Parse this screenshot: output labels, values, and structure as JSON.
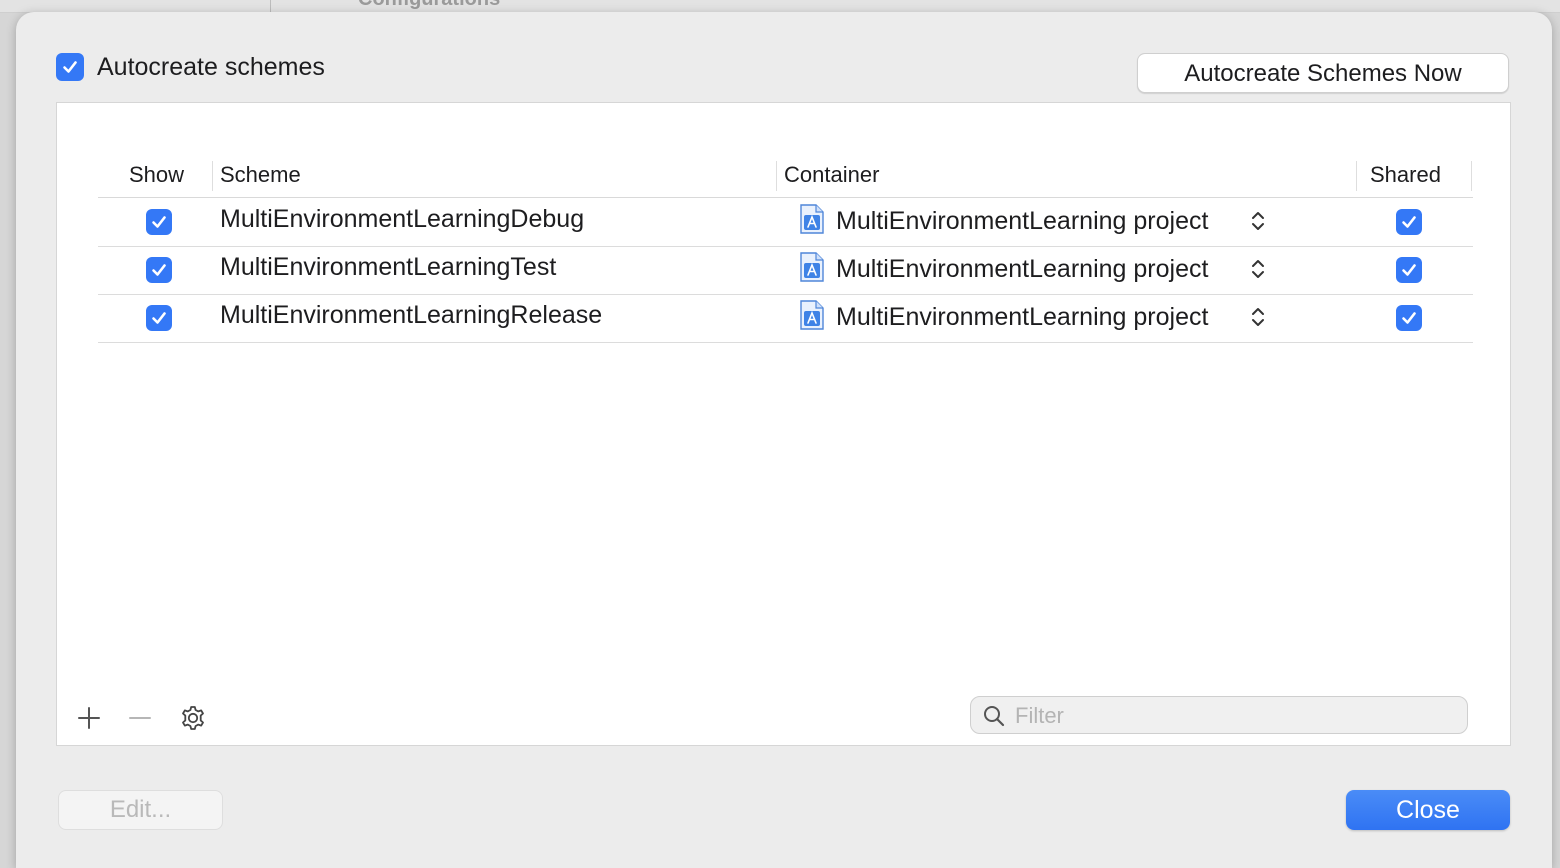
{
  "background": {
    "heading_text": "Configurations"
  },
  "header": {
    "autocreate_label": "Autocreate schemes",
    "autocreate_checked": true,
    "autocreate_now_label": "Autocreate Schemes Now"
  },
  "table": {
    "columns": {
      "show": "Show",
      "scheme": "Scheme",
      "container": "Container",
      "shared": "Shared"
    },
    "rows": [
      {
        "show": true,
        "scheme": "MultiEnvironmentLearningDebug",
        "container": "MultiEnvironmentLearning project",
        "shared": true
      },
      {
        "show": true,
        "scheme": "MultiEnvironmentLearningTest",
        "container": "MultiEnvironmentLearning project",
        "shared": true
      },
      {
        "show": true,
        "scheme": "MultiEnvironmentLearningRelease",
        "container": "MultiEnvironmentLearning project",
        "shared": true
      }
    ]
  },
  "toolbar": {
    "add_icon": "plus-icon",
    "remove_icon": "minus-icon",
    "settings_icon": "gear-icon",
    "filter_placeholder": "Filter",
    "filter_value": ""
  },
  "footer": {
    "edit_label": "Edit...",
    "close_label": "Close"
  },
  "colors": {
    "accent": "#3478f6",
    "sheet_bg": "#ececec",
    "disabled_text": "#b9b9b9"
  }
}
